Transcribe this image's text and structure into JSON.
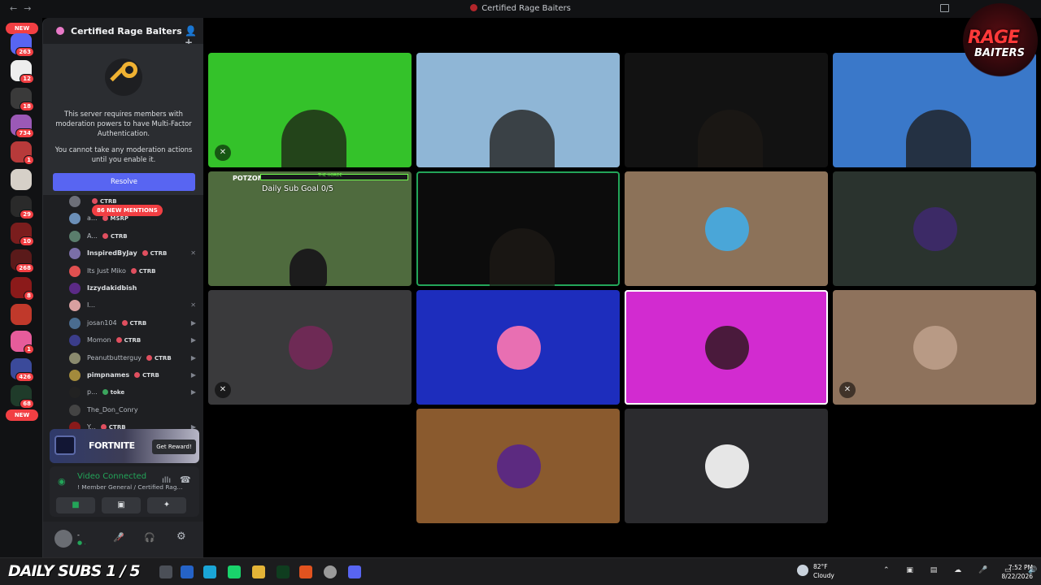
{
  "window": {
    "title": "Certified Rage Baiters",
    "nav_back": "←",
    "nav_fwd": "→"
  },
  "rail": {
    "new_top": "NEW",
    "new_bottom": "NEW",
    "badges": [
      "263",
      "12",
      "18",
      "734",
      "1",
      "29",
      "10",
      "268",
      "8",
      "1",
      "426",
      "68"
    ]
  },
  "server": {
    "name": "Certified Rage Baiters",
    "chevron": "⌄",
    "invite_icon": "👤+"
  },
  "mfa": {
    "message1": "This server requires members with moderation powers to have Multi-Factor Authentication.",
    "message2": "You cannot take any moderation actions until you enable it.",
    "resolve_label": "Resolve"
  },
  "mentions": "86 NEW MENTIONS",
  "members": [
    {
      "name": "",
      "tag": "CTRB",
      "tag_color": "red",
      "avatar": "#6d6f78"
    },
    {
      "name": "a...",
      "tag": "MSRP",
      "tag_color": "red",
      "avatar": "#6b8fb8"
    },
    {
      "name": "A...",
      "tag": "CTRB",
      "tag_color": "red",
      "avatar": "#5a7d6c"
    },
    {
      "name": "InspiredByJay",
      "tag": "CTRB",
      "tag_color": "red",
      "avatar": "#7b6fa8",
      "status": "✕",
      "bold": true
    },
    {
      "name": "Its Just Miko",
      "tag": "CTRB",
      "tag_color": "red",
      "avatar": "#e05050"
    },
    {
      "name": "Izzydakidbish",
      "tag": "",
      "tag_color": "red",
      "avatar": "#5b2a86",
      "bold": true
    },
    {
      "name": "I...",
      "tag": "",
      "tag_color": "red",
      "avatar": "#d9a0a0",
      "status": "✕"
    },
    {
      "name": "josan104",
      "tag": "CTRB",
      "tag_color": "red",
      "avatar": "#4a6c8f",
      "status": "▶"
    },
    {
      "name": "Momon",
      "tag": "CTRB",
      "tag_color": "red",
      "avatar": "#3b3d8a",
      "status": "▶"
    },
    {
      "name": "Peanutbutterguy",
      "tag": "CTRB",
      "tag_color": "red",
      "avatar": "#8a8a6e",
      "status": "▶"
    },
    {
      "name": "pimpnames",
      "tag": "CTRB",
      "tag_color": "red",
      "avatar": "#a38a3c",
      "status": "▶",
      "bold": true
    },
    {
      "name": "p...",
      "tag": "toke",
      "tag_color": "green",
      "avatar": "#222",
      "status": "▶"
    },
    {
      "name": "The_Don_Conry",
      "tag": "",
      "tag_color": "red",
      "avatar": "#444"
    },
    {
      "name": "Y...",
      "tag": "CTRB",
      "tag_color": "red",
      "avatar": "#8a1a1a",
      "status": "▶"
    }
  ],
  "promo": {
    "game": "FORTNITE",
    "button": "Get Reward!"
  },
  "voice": {
    "status": "Video Connected",
    "channel": "! Member General / Certified Rag...",
    "buttons": [
      "camera-icon",
      "screen-share-icon",
      "activities-icon",
      "soundboard-icon"
    ]
  },
  "user": {
    "name": "-",
    "status": "● .",
    "mic": "🎤̸",
    "headphones": "🎧",
    "settings": "⚙"
  },
  "tiles": [
    {
      "bg": "#34c22a",
      "kind": "video",
      "muted": true
    },
    {
      "bg": "#8fb6d6",
      "kind": "video",
      "muted": false
    },
    {
      "bg": "#121212",
      "kind": "video",
      "muted": false
    },
    {
      "bg": "#3a78c9",
      "kind": "video",
      "muted": false
    },
    {
      "bg": "#4f6b3e",
      "kind": "stream",
      "muted": false,
      "stream_name": "POTZOMBIE420",
      "overlay": "Daily Sub Goal 0/5",
      "bar_text": "THE HORDE"
    },
    {
      "bg": "#0c0c0c",
      "kind": "video",
      "muted": false,
      "speaking": true
    },
    {
      "bg": "#8c7259",
      "kind": "avatar",
      "muted": false,
      "avatar": "#4aa6d8"
    },
    {
      "bg": "#2a332e",
      "kind": "avatar",
      "muted": false,
      "avatar": "#3c2a66"
    },
    {
      "bg": "#3a3a3c",
      "kind": "avatar",
      "muted": true,
      "avatar": "#6e2a55"
    },
    {
      "bg": "#1d2dbd",
      "kind": "avatar",
      "muted": false,
      "avatar": "#e86fb2"
    },
    {
      "bg": "#d22bd0",
      "kind": "avatar",
      "muted": false,
      "avatar": "#4a1a3c",
      "selected": true
    },
    {
      "bg": "#8e725c",
      "kind": "avatar",
      "muted": true,
      "avatar": "#b89a85"
    },
    {
      "bg": "#8a5a2e",
      "kind": "avatar",
      "muted": false,
      "avatar": "#5c2a80"
    },
    {
      "bg": "#2b2b2e",
      "kind": "avatar",
      "muted": false,
      "avatar": "#e6e6e6"
    }
  ],
  "logo": {
    "line1": "RAGE",
    "line2": "BAITERS"
  },
  "taskbar": {
    "subs": "DAILY SUBS 1 / 5",
    "weather_temp": "82°F",
    "weather_cond": "Cloudy",
    "weather_badge": "4",
    "tray": "⌃ ▣ ▤ ☁ 🎤 ▭ 🔊 🔋",
    "time": "7:52 PM",
    "date": "8/22/2026"
  }
}
